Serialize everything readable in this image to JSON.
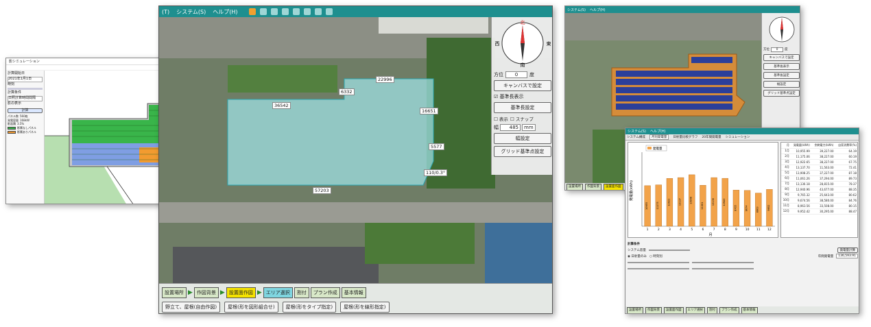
{
  "sim": {
    "title": "影シミュレーション",
    "window_controls": [
      "-",
      "□",
      "×"
    ],
    "left_labels": [
      "計算開始日",
      "2021年1月1日",
      "時刻",
      "計算条件",
      "日照計算時間間隔",
      "影の表示"
    ],
    "calc_button": "計算",
    "info": [
      {
        "label": "パネル数",
        "value": "560枚"
      },
      {
        "label": "発電容量",
        "value": "168kW"
      },
      {
        "label": "影面積",
        "value": "3.5%"
      }
    ],
    "legend": [
      {
        "label": "影響なしパネル",
        "color": "#39b54a"
      },
      {
        "label": "影響ありパネル",
        "color": "#f29b30"
      }
    ]
  },
  "main": {
    "menu": [
      "(T)",
      "システム(S)",
      "ヘルプ(H)"
    ],
    "compass": {
      "north": "北",
      "south": "南",
      "east": "東",
      "west": "西"
    },
    "azimuth_label": "方位",
    "azimuth_value": "0",
    "azimuth_unit": "度",
    "canvas_button": "キャンバスで設定",
    "show_baseline": "基準長表示",
    "baseline_button": "基準長設定",
    "grid_label": "表示",
    "snap_label": "スナップ",
    "width_label": "幅",
    "width_value": "485",
    "width_unit": "mm",
    "apply_button": "幅設定",
    "grid_button": "グリッド基準点設定",
    "dims": [
      "22996",
      "6332",
      "36542",
      "16651",
      "5577",
      "110/0.3°",
      "57203"
    ],
    "steps": [
      "設置場所",
      "作図背景",
      "設置面作図",
      "エリア選択",
      "割付",
      "プラン作成",
      "基本情報"
    ],
    "tools": [
      "野立て、屋根(自由作図)",
      "屋根(形を図形組合せ)",
      "屋根(形をタイプ指定)",
      "屋根(形を線形指定)"
    ]
  },
  "rtop": {
    "menu": [
      "システム(S)",
      "ヘルプ(H)"
    ],
    "azimuth_label": "方位",
    "azimuth_value": "0",
    "azimuth_unit": "度",
    "buttons": [
      "キャンバスで設定",
      "基準長表示",
      "基準長設定",
      "幅設定",
      "グリッド基準点設定"
    ],
    "foot": [
      "設置場所",
      "作図背景",
      "設置面作図"
    ]
  },
  "rbot": {
    "menu": [
      "システム(S)",
      "ヘルプ(H)"
    ],
    "tabs": [
      "システム構成",
      "月別発電量",
      "日射量比較グラフ",
      "20年間発電量",
      "シミュレーション"
    ],
    "legend": "発電量",
    "xlabel": "月",
    "ylabel": "発電量(kWh)",
    "table_headers": [
      "月",
      "発電量(kWh)",
      "余剰電力(kWh)",
      "自家消費率(%)"
    ],
    "table_rows": [
      [
        "1月",
        "10,955.99",
        "39,227.00",
        "64.19"
      ],
      [
        "2月",
        "11,175.06",
        "38,227.00",
        "60.19"
      ],
      [
        "3月",
        "12,922.65",
        "38,227.00",
        "67.75"
      ],
      [
        "4月",
        "13,137.70",
        "11,563.00",
        "72.41"
      ],
      [
        "5月",
        "13,908.25",
        "37,227.00",
        "87.18"
      ],
      [
        "6月",
        "11,061.26",
        "37,294.00",
        "89.73"
      ],
      [
        "7月",
        "13,136.18",
        "28,815.00",
        "78.37"
      ],
      [
        "8月",
        "12,940.96",
        "43,677.00",
        "88.35"
      ],
      [
        "9月",
        "9,765.32",
        "25,643.00",
        "80.62"
      ],
      [
        "10月",
        "9,674.56",
        "38,580.00",
        "84.76"
      ],
      [
        "11月",
        "8,963.56",
        "33,508.00",
        "80.15"
      ],
      [
        "12月",
        "9,952.42",
        "30,295.00",
        "88.47"
      ]
    ],
    "settings_title": "計算条件",
    "system_capacity": "システム容量",
    "calc_button": "発電量計算",
    "radio_daily": "日射量のみ",
    "radio_hourly": "時刻別",
    "totals_label": "年間発電量",
    "total_value": "136,593.91",
    "footer": [
      "設置場所",
      "作図背景",
      "設置面作図",
      "エリア選択",
      "割付",
      "プラン作成",
      "基本情報"
    ]
  },
  "chart_data": {
    "type": "bar",
    "categories": [
      "1",
      "2",
      "3",
      "4",
      "5",
      "6",
      "7",
      "8",
      "9",
      "10",
      "11",
      "12"
    ],
    "values": [
      10955,
      11175,
      12922,
      13137,
      13908,
      11061,
      13136,
      12940,
      9765,
      9674,
      8963,
      9952
    ],
    "value_labels": [
      "10955",
      "11175",
      "12922",
      "13137",
      "13908",
      "11061",
      "13136",
      "12940",
      "9765",
      "9674",
      "8963",
      "9952"
    ],
    "xlabel": "月",
    "ylabel": "発電量(kWh)",
    "ylim": [
      0,
      20000
    ],
    "color": "#f2a34a"
  },
  "colors": {
    "menubar": "#1e8f8f",
    "area_fill": "#9fe3e8",
    "panel_blue": "#3a4a9a",
    "panel_green": "#39b54a",
    "panel_orange": "#f29b30"
  }
}
